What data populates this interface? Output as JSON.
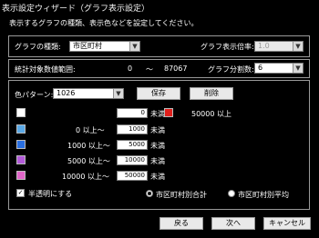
{
  "window": {
    "title": "表示設定ウィザード（グラフ表示設定）"
  },
  "instruction": "表示するグラフの種類、表示色などを設定してください。",
  "graph_type": {
    "label": "グラフの種類:",
    "value": "市区町村"
  },
  "graph_scale": {
    "label": "グラフ表示倍率:",
    "value": "1.0"
  },
  "stats": {
    "range_label": "統計対象数値範囲:",
    "min": "0",
    "tilde": "〜",
    "max": "87067",
    "divisions_label": "グラフ分割数:",
    "divisions_value": "6"
  },
  "palette": {
    "label": "色パターン:",
    "value": "1026",
    "save_label": "保存",
    "delete_label": "削除"
  },
  "bands": [
    {
      "low_label": "",
      "value": "0",
      "unit": "未満",
      "color": "#ffffff"
    },
    {
      "low_label": "0 以上〜",
      "value": "1000",
      "unit": "未満",
      "color": "#5aa9e6"
    },
    {
      "low_label": "1000 以上〜",
      "value": "5000",
      "unit": "未満",
      "color": "#2a6fe0"
    },
    {
      "low_label": "5000 以上〜",
      "value": "10000",
      "unit": "未満",
      "color": "#b25ad8"
    },
    {
      "low_label": "10000 以上〜",
      "value": "50000",
      "unit": "未満",
      "color": "#e066c8"
    }
  ],
  "top_band": {
    "label": "50000 以上",
    "color": "#e0201c"
  },
  "semi_transparent": {
    "label": "半透明にする",
    "checked": true
  },
  "aggregate": {
    "option_total": "市区町村別合計",
    "option_average": "市区町村別平均",
    "selected": "total"
  },
  "footer": {
    "back_label": "戻る",
    "next_label": "次へ",
    "cancel_label": "キャンセル"
  }
}
